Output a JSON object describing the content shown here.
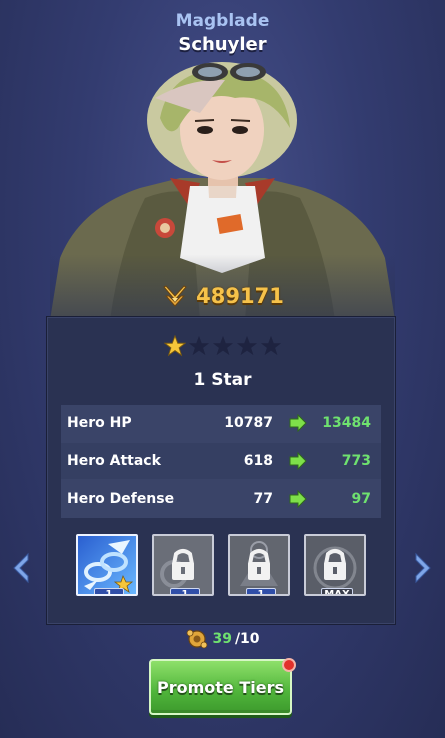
{
  "hero": {
    "class_name": "Magblade",
    "name": "Schuyler"
  },
  "power": {
    "icon": "crossed-swords-icon",
    "value": "489171"
  },
  "stars": {
    "filled": 1,
    "total": 5,
    "tier_label": "1 Star"
  },
  "stats": [
    {
      "name": "Hero HP",
      "current": "10787",
      "next": "13484"
    },
    {
      "name": "Hero Attack",
      "current": "618",
      "next": "773"
    },
    {
      "name": "Hero Defense",
      "current": "77",
      "next": "97"
    }
  ],
  "skills": [
    {
      "icon": "chain-blade-skill-icon",
      "level": "1",
      "locked": false
    },
    {
      "icon": "lock-icon",
      "level": "1",
      "locked": true
    },
    {
      "icon": "lock-icon",
      "level": "1",
      "locked": true
    },
    {
      "icon": "lock-icon",
      "level": "MAX",
      "locked": true
    }
  ],
  "cost": {
    "icon": "gear-token-icon",
    "have": "39",
    "need": "/10"
  },
  "promote_button": {
    "label": "Promote Tiers"
  },
  "colors": {
    "accent_green": "#6fe16f",
    "power_gold": "#f6c24a",
    "class_blue": "#a9c3f2"
  }
}
